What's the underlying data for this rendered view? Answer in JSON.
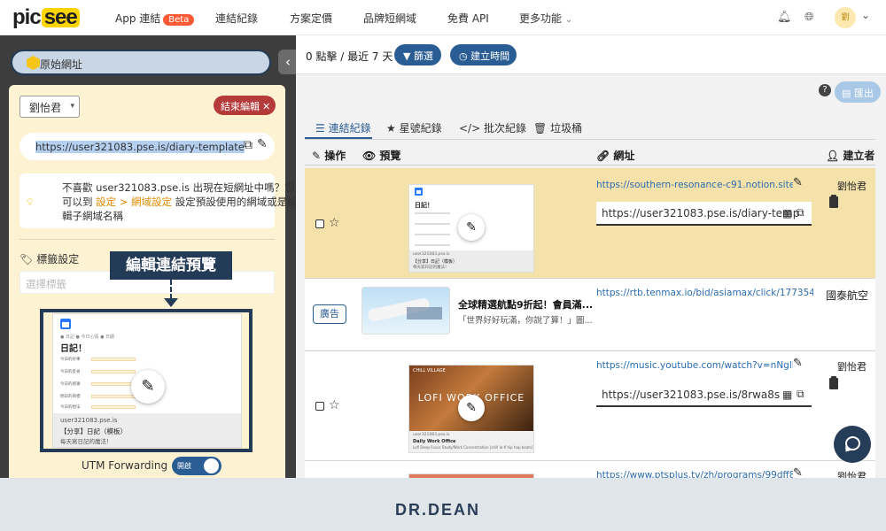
{
  "nav": {
    "logo_pic": "pic",
    "logo_see": "see",
    "items": [
      {
        "label": "App 連結",
        "badge": "Beta"
      },
      {
        "label": "連結紀錄"
      },
      {
        "label": "方案定價"
      },
      {
        "label": "品牌短網域"
      },
      {
        "label": "免費 API"
      },
      {
        "label": "更多功能"
      }
    ],
    "bell_icon": "bell-icon",
    "globe_icon": "globe-icon",
    "avatar_text": "劉",
    "chevron": "⌄"
  },
  "left": {
    "original_url_label": "原始網址",
    "owner_select": "劉怡君",
    "end_edit_label": "結束編輯",
    "short_url": "https://user321083.pse.is/diary-template",
    "hint_line1": "不喜歡 user321083.pse.is 出現在短網址中嗎？您",
    "hint_line2a": "可以到 ",
    "hint_link": "設定 > 網域設定",
    "hint_line2b": " 設定預設使用的網域或是編",
    "hint_line3": "輯子網域名稱",
    "tag_title": "標籤設定",
    "tag_placeholder": "選擇標籤",
    "callout": "編輯連結預覽",
    "preview": {
      "heading": "日記！",
      "meta": "● 日記  ● 今日心情  ● 日期",
      "rows": [
        "今日的好事",
        "今日的反省",
        "今日的感謝",
        "明日的目標",
        "今日的想法"
      ],
      "domain": "user321083.pse.is",
      "title": "【分享】日記（模板）",
      "desc": "每天寫日記的魔法！"
    },
    "utm_label": "UTM Forwarding",
    "utm_toggle": "開啟"
  },
  "toolbar": {
    "clicks": "0 點擊 / 最近 7 天",
    "filter_label": "篩選",
    "time_label": "建立時間",
    "export_label": "匯出"
  },
  "tabs": [
    {
      "label": "連結紀錄",
      "icon": "list-icon",
      "active": true
    },
    {
      "label": "星號紀錄",
      "icon": "star-icon"
    },
    {
      "label": "批次紀錄",
      "icon": "code-icon"
    },
    {
      "label": "垃圾桶",
      "icon": "trash-icon"
    }
  ],
  "table_headers": {
    "actions": "操作",
    "preview": "預覽",
    "url": "網址",
    "creator": "建立者"
  },
  "rows": [
    {
      "link": "https://southern-resonance-c91.notion.site/15a1",
      "short": "https://user321083.pse.is/diary-temp",
      "creator": "劉怡君",
      "thumb_heading": "日記！",
      "thumb_domain": "user321083.pse.is",
      "thumb_title": "【分享】日記（模板）",
      "thumb_desc": "每天寫日記的魔法！"
    },
    {
      "ad_badge": "廣告",
      "ad_title": "全球精選航點9折起！會員滿...",
      "ad_desc": "「世界好好玩滿，你說了算！」圖...",
      "link": "https://rtb.tenmax.io/bid/asiamax/click/177354219...",
      "creator": "國泰航空"
    },
    {
      "link": "https://music.youtube.com/watch?v=nNglMdc6w",
      "short": "https://user321083.pse.is/8rwa8s",
      "creator": "劉怡君",
      "thumb_banner": "LOFI WORK OFFICE",
      "thumb_tag": "CHILL VILLAGE",
      "thumb_domain": "user321083.pse.is",
      "thumb_title": "Daily Work Office",
      "thumb_desc": "Lofi Deep Focus Study/Work Concentration [chill lo-fi hip hop beats]"
    },
    {
      "link": "https://www.ptsplus.tv/zh/programs/99dff839-8f23-",
      "creator": "劉怡君"
    }
  ],
  "footer_brand": "DR.DEAN",
  "colors": {
    "navy": "#2b5d95",
    "dark_navy": "#243b57",
    "highlight": "#f5e2ab",
    "card": "#fdf2d2",
    "danger": "#b53a3a",
    "beta": "#ff5a36"
  }
}
